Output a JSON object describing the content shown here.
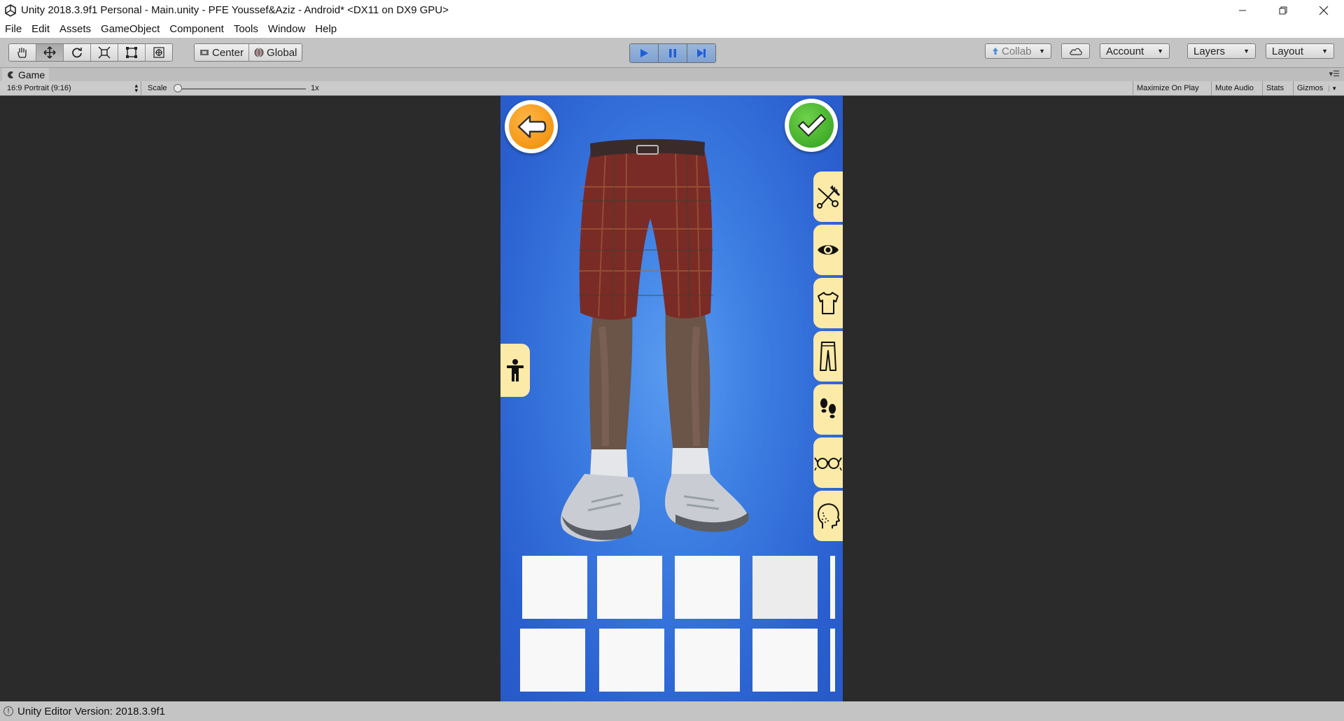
{
  "window": {
    "title": "Unity 2018.3.9f1 Personal - Main.unity - PFE Youssef&Aziz - Android* <DX11 on DX9 GPU>"
  },
  "menu": [
    "File",
    "Edit",
    "Assets",
    "GameObject",
    "Component",
    "Tools",
    "Window",
    "Help"
  ],
  "toolbar": {
    "pivot_mode": "Center",
    "pivot_rotation": "Global",
    "collab_label": "Collab",
    "account_label": "Account",
    "layers_label": "Layers",
    "layout_label": "Layout"
  },
  "game_tab": {
    "label": "Game"
  },
  "game_view": {
    "aspect": "16:9 Portrait (9:16)",
    "scale_label": "Scale",
    "scale_value": "1x",
    "buttons": [
      "Maximize On Play",
      "Mute Audio",
      "Stats",
      "Gizmos"
    ]
  },
  "status": {
    "text": "Unity Editor Version: 2018.3.9f1"
  },
  "game": {
    "back_icon": "back-arrow-icon",
    "confirm_icon": "checkmark-icon",
    "category_icons": [
      "scissors-hair-icon",
      "eye-icon",
      "tshirt-icon",
      "pants-icon",
      "footprints-icon",
      "glasses-icon",
      "head-icon"
    ],
    "pose_icon": "person-pose-icon",
    "colors": {
      "background": "#3d7fe3",
      "tab": "#fceaa8",
      "back_button": "#f39c12",
      "confirm_button": "#43b02a"
    }
  }
}
